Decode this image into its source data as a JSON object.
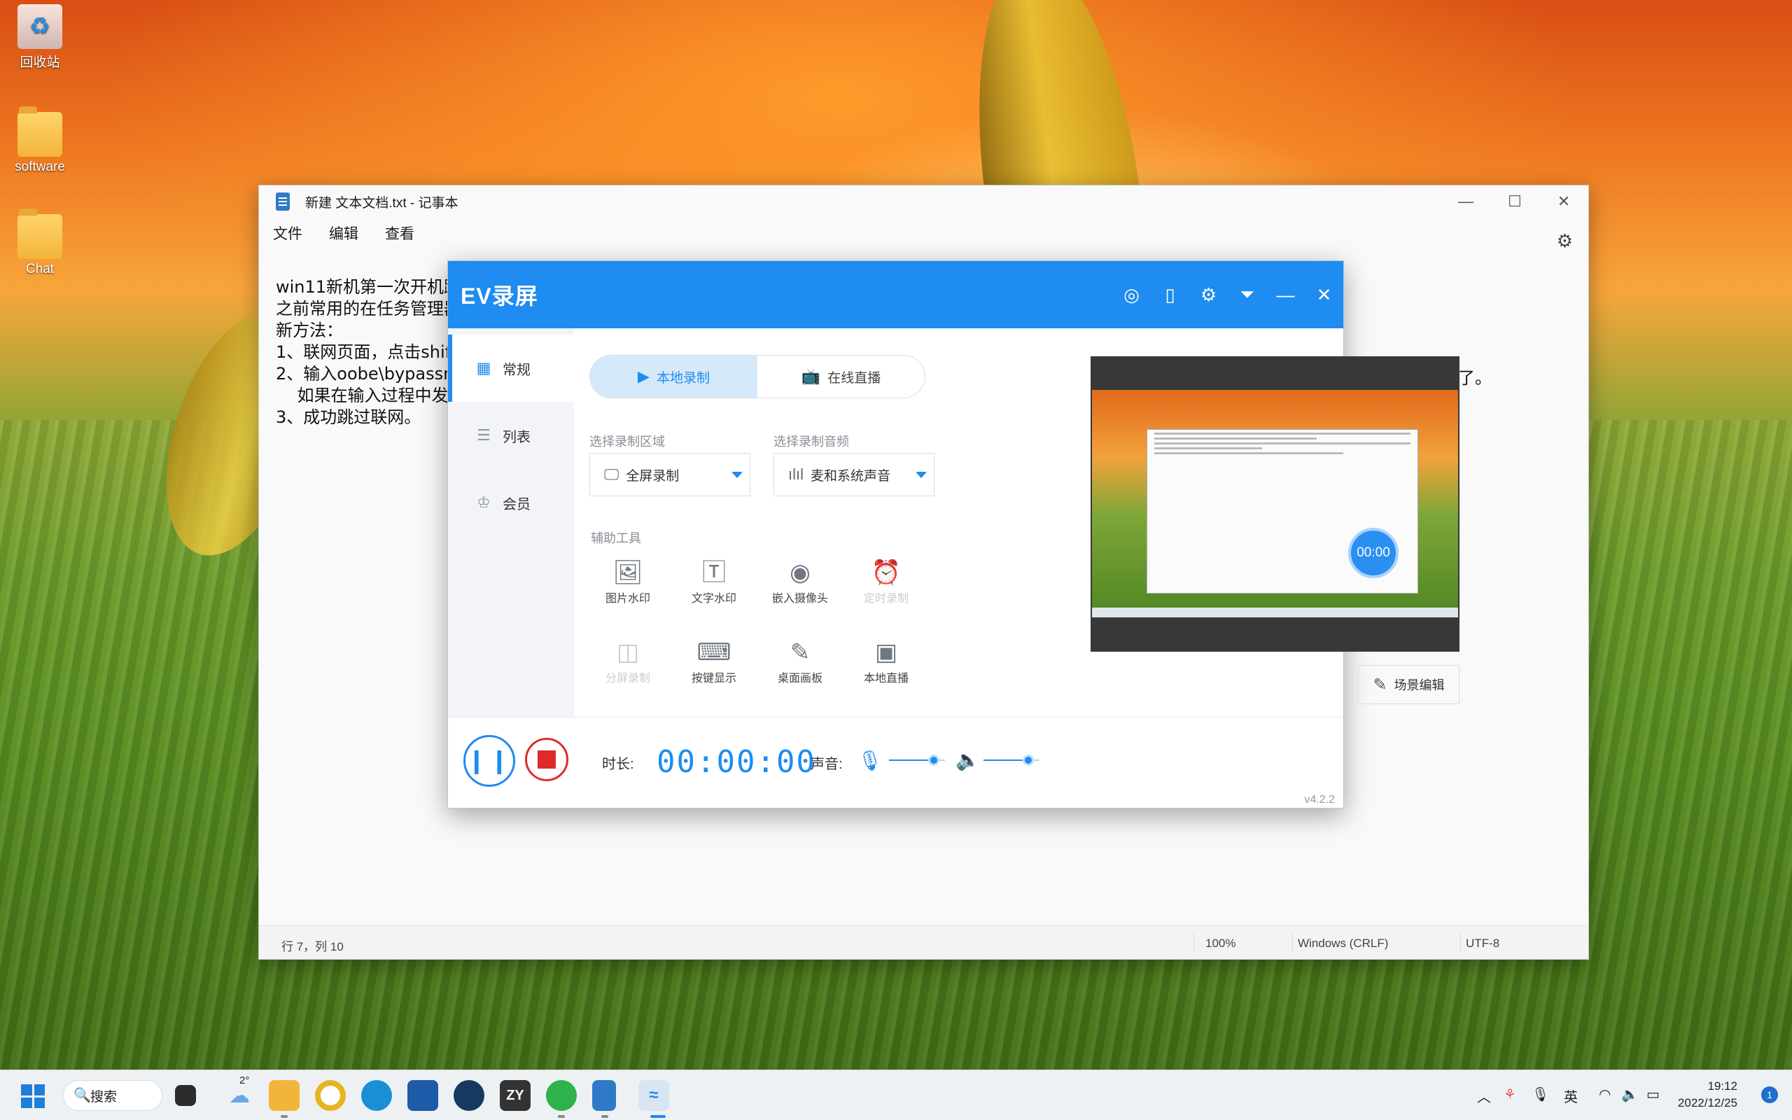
{
  "desktop": {
    "icons": [
      {
        "label": "回收站",
        "icon": "recycle-bin-icon"
      },
      {
        "label": "software",
        "icon": "folder-icon"
      },
      {
        "label": "Chat",
        "icon": "folder-icon"
      }
    ]
  },
  "notepad": {
    "title": "新建 文本文档.txt - 记事本",
    "menu": [
      "文件",
      "编辑",
      "查看"
    ],
    "lines": [
      "win11新机第一次开机跳",
      "之前常用的在任务管理器",
      "新方法：",
      "1、联网页面，点击shif",
      "2、输入oobe\\bypassn",
      "    如果在输入过程中发",
      "3、成功跳过联网。"
    ],
    "line_tail": "这个就可以跳过了。",
    "status": {
      "position": "行 7，列 10",
      "zoom": "100%",
      "line_ending": "Windows (CRLF)",
      "encoding": "UTF-8"
    }
  },
  "ev": {
    "title": "EV录屏",
    "sidebar": [
      {
        "label": "常规",
        "icon": "grid-icon"
      },
      {
        "label": "列表",
        "icon": "list-icon"
      },
      {
        "label": "会员",
        "icon": "crown-icon"
      }
    ],
    "tabs": {
      "local": "本地录制",
      "live": "在线直播"
    },
    "region": {
      "label": "选择录制区域",
      "value": "全屏录制"
    },
    "audio": {
      "label": "选择录制音频",
      "value": "麦和系统声音"
    },
    "tools_label": "辅助工具",
    "tools": [
      {
        "label": "图片水印",
        "icon": "image-icon"
      },
      {
        "label": "文字水印",
        "icon": "text-icon"
      },
      {
        "label": "嵌入摄像头",
        "icon": "camera-icon"
      },
      {
        "label": "定时录制",
        "icon": "alarm-icon"
      },
      {
        "label": "分屏录制",
        "icon": "split-screen-icon"
      },
      {
        "label": "按键显示",
        "icon": "keyboard-icon"
      },
      {
        "label": "桌面画板",
        "icon": "easel-icon"
      },
      {
        "label": "本地直播",
        "icon": "monitor-play-icon"
      }
    ],
    "preview_timer": "00:00",
    "scene_edit": "场景编辑",
    "duration_label": "时长:",
    "duration": "00:00:00",
    "sound_label": "声音:",
    "mic_level": 0.8,
    "speaker_level": 0.8,
    "version": "v4.2.2",
    "accent": "#1e8cf0"
  },
  "taskbar": {
    "search": "搜索",
    "weather": "2°",
    "ime": "英",
    "time": "19:12",
    "date": "2022/12/25",
    "notifications": "1"
  }
}
